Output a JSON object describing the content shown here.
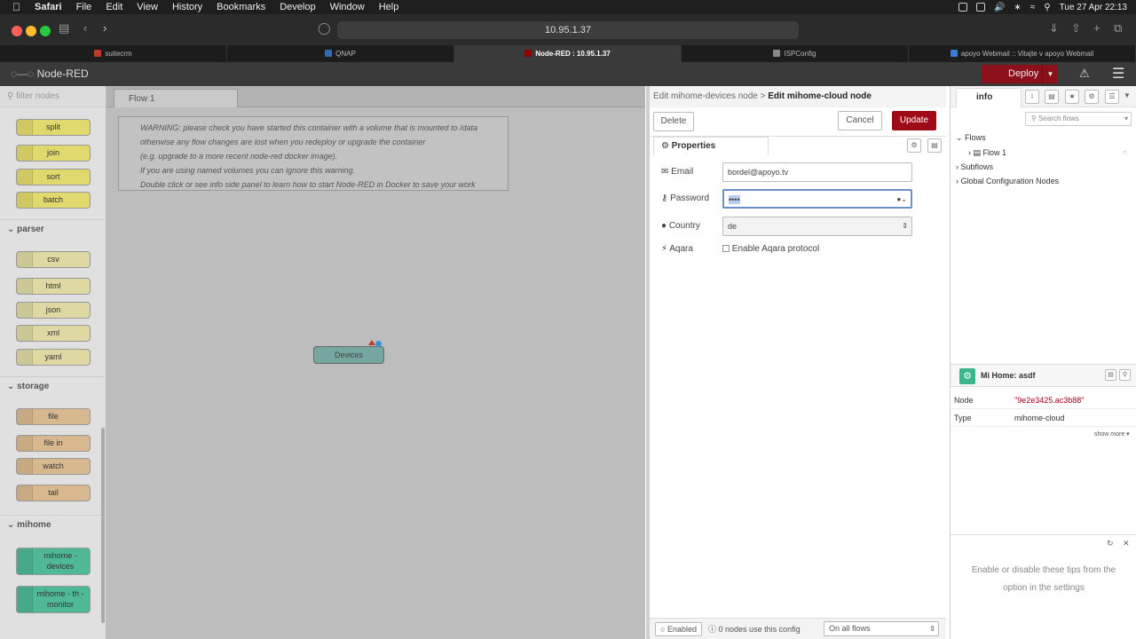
{
  "macos": {
    "menu": [
      "Safari",
      "File",
      "Edit",
      "View",
      "History",
      "Bookmarks",
      "Develop",
      "Window",
      "Help"
    ],
    "clock": "Tue 27 Apr  22:13"
  },
  "browser": {
    "url": "10.95.1.37",
    "tabs": [
      {
        "label": "suitecrm",
        "color": "#c0392b"
      },
      {
        "label": "QNAP",
        "color": "#2c6fb7"
      },
      {
        "label": "Node-RED : 10.95.1.37",
        "color": "#8f0000",
        "active": true
      },
      {
        "label": "ISPConfig",
        "color": "#888888"
      },
      {
        "label": "apoyo Webmail :: Vitajte v apoyo Webmail",
        "color": "#3a7bd5"
      }
    ]
  },
  "nodered": {
    "title": "Node-RED",
    "deploy_label": "Deploy",
    "filter_placeholder": "filter nodes",
    "palette": {
      "function_nodes": [
        "split",
        "join",
        "sort",
        "batch"
      ],
      "categories": {
        "parser": "parser",
        "storage": "storage",
        "mihome": "mihome"
      },
      "parser_nodes": [
        "csv",
        "html",
        "json",
        "xml",
        "yaml"
      ],
      "storage_nodes": [
        "file",
        "file in",
        "watch",
        "tail"
      ],
      "mihome_nodes": [
        "mihome - devices",
        "mihome - th - monitor"
      ]
    },
    "workspace": {
      "tab": "Flow 1",
      "comment_lines": [
        "WARNING: please check you have started this container with a volume that is mounted to /data",
        "otherwise any flow changes are lost when you redeploy or upgrade the container",
        "(e.g. upgrade to a more recent node-red docker image).",
        "If you are using named volumes you can ignore this warning.",
        "Double click or see info side panel to learn how to start Node-RED in Docker to save your work"
      ],
      "node_label": "Devices"
    },
    "editor": {
      "breadcrumb_parent": "Edit mihome-devices node",
      "breadcrumb_sep": ">",
      "breadcrumb_current": "Edit mihome-cloud node",
      "delete": "Delete",
      "cancel": "Cancel",
      "update": "Update",
      "properties_tab": "Properties",
      "email_label": "Email",
      "email_value": "bordel@apoyo.tv",
      "password_label": "Password",
      "password_value": "••••",
      "country_label": "Country",
      "country_value": "de",
      "aqara_label": "Aqara",
      "aqara_checkbox": "Enable Aqara protocol",
      "enabled": "Enabled",
      "usage": "0 nodes use this config",
      "scope": "On all flows"
    },
    "sidebar": {
      "tab": "info",
      "search_placeholder": "Search flows",
      "tree": {
        "flows": "Flows",
        "flow1": "Flow 1",
        "subflows": "Subflows",
        "global": "Global Configuration Nodes"
      },
      "node_title": "Mi Home: asdf",
      "props": [
        {
          "key": "Node",
          "value": "\"9e2e3425.ac3b88\""
        },
        {
          "key": "Type",
          "value": "mihome-cloud"
        }
      ],
      "show_more": "show more ▾",
      "tip": "Enable or disable these tips from the option in the settings"
    }
  }
}
